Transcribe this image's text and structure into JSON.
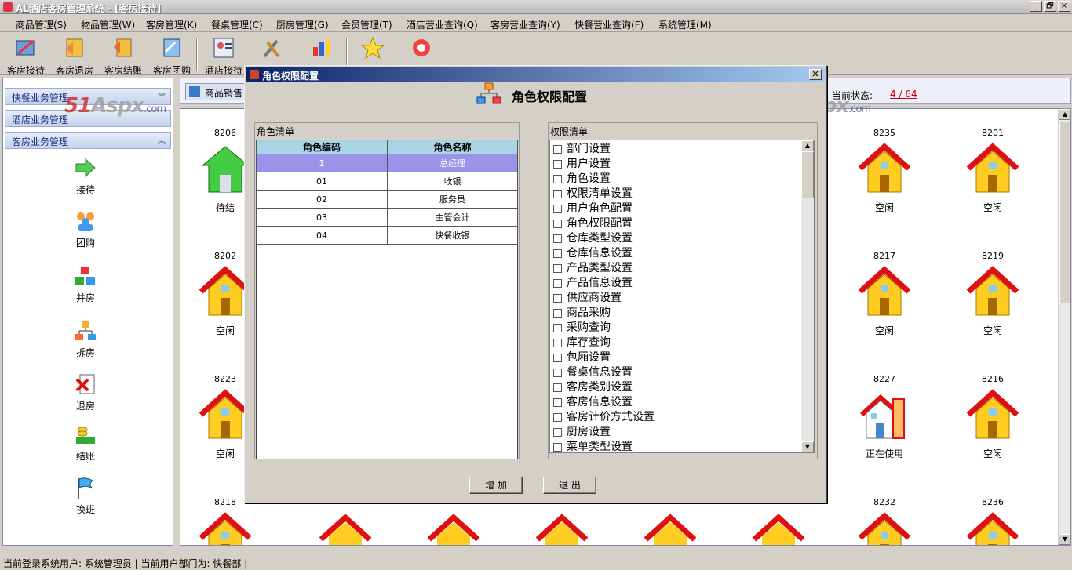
{
  "app": {
    "title": "AL酒店客房管理系统 - [客房接待]",
    "min": "_",
    "max": "🗗",
    "close": "×"
  },
  "menu": [
    "商品管理(S)",
    "物品管理(W)",
    "客房管理(K)",
    "餐桌管理(C)",
    "厨房管理(G)",
    "会员管理(T)",
    "酒店营业查询(Q)",
    "客房营业查询(Y)",
    "快餐营业查询(F)",
    "系统管理(M)"
  ],
  "toolbar": [
    {
      "label": "客房接待",
      "icon": "checkin-icon"
    },
    {
      "label": "客房退房",
      "icon": "checkout-icon"
    },
    {
      "label": "客房结账",
      "icon": "bill-icon"
    },
    {
      "label": "客房团购",
      "icon": "group-buy-icon"
    },
    {
      "label": "酒店接待",
      "icon": "reception-icon"
    },
    {
      "label": "",
      "icon": "tools-icon"
    },
    {
      "label": "",
      "icon": "report-icon"
    },
    {
      "label": "",
      "icon": "star-icon"
    },
    {
      "label": "",
      "icon": "settings-icon"
    }
  ],
  "sidebar": {
    "sections": [
      "快餐业务管理",
      "酒店业务管理",
      "客房业务管理"
    ],
    "items": [
      {
        "label": "接待",
        "icon": "arrow-right-icon"
      },
      {
        "label": "团购",
        "icon": "people-icon"
      },
      {
        "label": "并房",
        "icon": "cubes-icon"
      },
      {
        "label": "拆房",
        "icon": "split-icon"
      },
      {
        "label": "退房",
        "icon": "cancel-doc-icon"
      },
      {
        "label": "结账",
        "icon": "coins-icon"
      },
      {
        "label": "换班",
        "icon": "flag-icon"
      }
    ]
  },
  "tab": {
    "label": "商品销售"
  },
  "status": {
    "label": "当前状态:",
    "value": "4 / 64"
  },
  "rooms": [
    {
      "num": "8206",
      "status": "待结"
    },
    {
      "num": "8235",
      "status": "空闲"
    },
    {
      "num": "8201",
      "status": "空闲"
    },
    {
      "num": "8202",
      "status": "空闲"
    },
    {
      "num": "8217",
      "status": "空闲"
    },
    {
      "num": "8219",
      "status": "空闲"
    },
    {
      "num": "8223",
      "status": "空闲"
    },
    {
      "num": "8227",
      "status": "正在使用"
    },
    {
      "num": "8216",
      "status": "空闲"
    },
    {
      "num": "8218",
      "status": ""
    },
    {
      "num": "8232",
      "status": ""
    },
    {
      "num": "8236",
      "status": ""
    }
  ],
  "statusbar": {
    "text": "当前登录系统用户: 系统管理员 | 当前用户部门为: 快餐部 |"
  },
  "watermark": {
    "brand": "51",
    "aspx": "Aspx",
    "com": ".com"
  },
  "dialog": {
    "title": "角色权限配置",
    "heading": "角色权限配置",
    "role_group": "角色清单",
    "perm_group": "权限清单",
    "columns": [
      "角色编码",
      "角色名称"
    ],
    "roles": [
      {
        "code": "1",
        "name": "总经理"
      },
      {
        "code": "01",
        "name": "收银"
      },
      {
        "code": "02",
        "name": "服务员"
      },
      {
        "code": "03",
        "name": "主管会计"
      },
      {
        "code": "04",
        "name": "快餐收银"
      }
    ],
    "permissions": [
      "部门设置",
      "用户设置",
      "角色设置",
      "权限清单设置",
      "用户角色配置",
      "角色权限配置",
      "仓库类型设置",
      "仓库信息设置",
      "产品类型设置",
      "产品信息设置",
      "供应商设置",
      "商品采购",
      "采购查询",
      "库存查询",
      "包厢设置",
      "餐桌信息设置",
      "客房类别设置",
      "客房信息设置",
      "客房计价方式设置",
      "厨房设置",
      "菜单类型设置"
    ],
    "add_button": "增 加",
    "exit_button": "退 出"
  }
}
